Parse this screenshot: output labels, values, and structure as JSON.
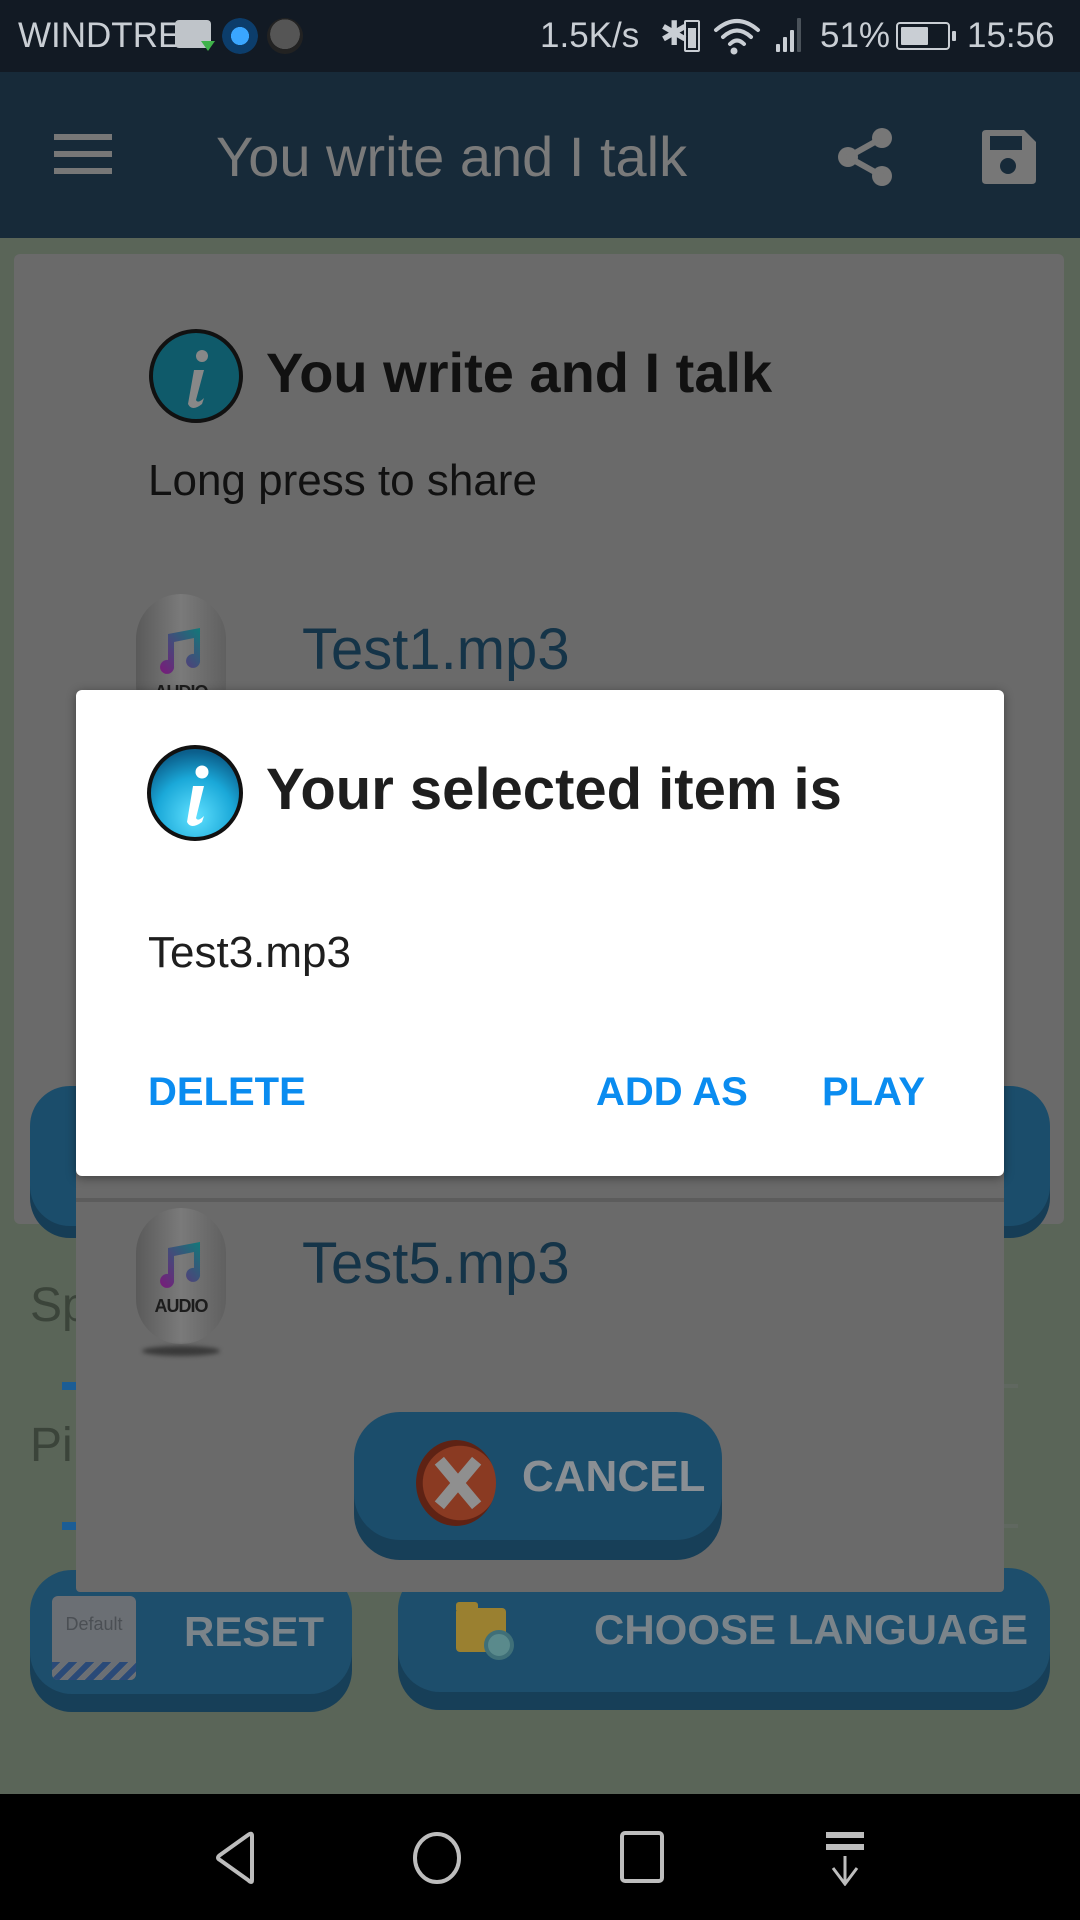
{
  "status_bar": {
    "carrier": "WINDTRE",
    "notification_icons": [
      "message-download-icon",
      "app-icon",
      "avatar-icon"
    ],
    "network_speed": "1.5K/s",
    "bluetooth": "bluetooth-icon",
    "wifi": "wifi-icon",
    "signal": "signal-icon",
    "battery_percent": "51%",
    "battery_level": 0.51,
    "time": "15:56"
  },
  "app_bar": {
    "menu_icon": "hamburger-menu-icon",
    "title": "You write and I talk",
    "actions": [
      "share-icon",
      "save-icon"
    ]
  },
  "background": {
    "speed_label": "Sp",
    "pitch_label": "Pi",
    "reset_button": {
      "label": "RESET",
      "icon_text": "Default"
    },
    "choose_language_button": {
      "label": "CHOOSE LANGUAGE"
    }
  },
  "list_dialog": {
    "title": "You write and I talk",
    "subtitle": "Long press to share",
    "items": [
      {
        "name": "Test1.mp3",
        "icon_text": "AUDIO"
      },
      {
        "name": "Test5.mp3",
        "icon_text": "AUDIO"
      }
    ],
    "cancel_label": "CANCEL"
  },
  "alert_dialog": {
    "title": "Your selected item is",
    "message": "Test3.mp3",
    "buttons": {
      "delete": "DELETE",
      "add_as": "ADD AS",
      "play": "PLAY"
    },
    "accent_color": "#0a8cf0"
  },
  "nav_bar": {
    "buttons": [
      "back-icon",
      "home-icon",
      "recent-apps-icon",
      "notification-pull-icon"
    ]
  }
}
